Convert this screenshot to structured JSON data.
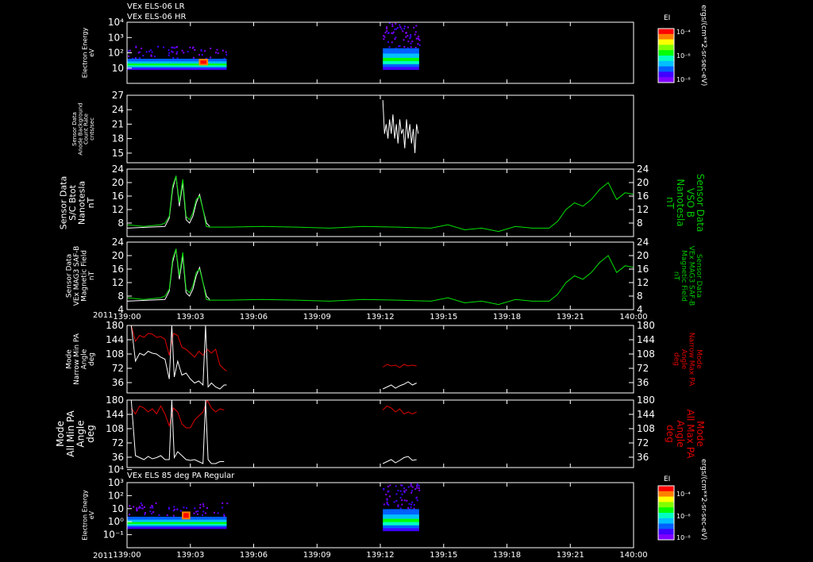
{
  "header": {
    "line1": "VEx ELS-06 LR",
    "line2": "VEx ELS-06 HR",
    "bottom_title": "VEx ELS 85 deg PA Regular",
    "year_label": "2011"
  },
  "colorbar": {
    "title": "EI",
    "unit": "ergs/(cm**2-sr-sec-eV)",
    "ticks": [
      "10⁻⁴",
      "10⁻⁶",
      "10⁻⁸"
    ],
    "colors": [
      "#ff0000",
      "#ff8000",
      "#ffff00",
      "#80ff00",
      "#00ff00",
      "#00ffc0",
      "#00c0ff",
      "#0060ff",
      "#4000ff",
      "#8000ff"
    ]
  },
  "colors": {
    "white": "#ffffff",
    "green": "#00e000",
    "red": "#e00000",
    "frame": "#ffffff",
    "label_green": "#00c800",
    "label_red": "#e00000"
  },
  "chart_data": {
    "type": "line",
    "x_tick_labels": [
      "139:00",
      "139:03",
      "139:06",
      "139:09",
      "139:12",
      "139:15",
      "139:18",
      "139:21",
      "140:00"
    ],
    "xlim": [
      0,
      60
    ],
    "x_unit": "minutes after 139:00",
    "panels": [
      {
        "id": "els-lr-hr",
        "type": "heatmap",
        "ylabel": [
          "Electron Energy",
          "eV"
        ],
        "ytick_labels": [
          "10",
          "10²",
          "10³",
          "10⁴"
        ],
        "ylog": true,
        "ylim": [
          1,
          10000
        ],
        "segments": [
          {
            "x0": 0,
            "x1": 11.8,
            "y_band": [
              8,
              300
            ],
            "peak_x": [
              8.5,
              9.6
            ],
            "peak_y": [
              15,
              40
            ]
          },
          {
            "x0": 30.3,
            "x1": 34.6,
            "y_band": [
              8,
              10000
            ],
            "peak_y": [
              10,
              40
            ]
          }
        ]
      },
      {
        "id": "anode-background",
        "ylabel": [
          "Sensor Data",
          "Anode Background",
          "Count Rate",
          "cnts/sec"
        ],
        "ytick_labels": [
          "15",
          "18",
          "21",
          "24",
          "27"
        ],
        "ylim": [
          13,
          27
        ],
        "series": [
          {
            "color_key": "white",
            "x": [
              30.3,
              30.5,
              30.7,
              30.9,
              31.1,
              31.3,
              31.5,
              31.7,
              31.9,
              32.1,
              32.3,
              32.5,
              32.7,
              32.9,
              33.1,
              33.3,
              33.5,
              33.7,
              33.9,
              34.1,
              34.3,
              34.5
            ],
            "y": [
              26,
              19,
              21,
              18,
              22,
              19,
              23,
              18,
              21,
              17,
              22,
              19,
              20,
              16,
              22,
              18,
              21,
              17,
              20,
              15,
              21,
              19
            ]
          }
        ]
      },
      {
        "id": "bmag-sc",
        "ylabel": [
          "Sensor Data",
          "S/C Btot",
          "Nanotesla",
          "nT"
        ],
        "ylabel_right": [
          "Sensor Data",
          "VSO B",
          "Nanotesla",
          "nT"
        ],
        "ytick_labels": [
          "8",
          "12",
          "16",
          "20",
          "24"
        ],
        "ylim": [
          4,
          24
        ],
        "series": [
          {
            "color_key": "white",
            "x": [
              0,
              4.5,
              5.0,
              5.4,
              5.8,
              6.2,
              6.6,
              7.0,
              7.4,
              7.8,
              8.2,
              8.6,
              9.0,
              9.4,
              9.8
            ],
            "y": [
              6.5,
              7.0,
              9.5,
              18.0,
              22.0,
              13.0,
              20.0,
              9.0,
              8.0,
              10.0,
              14.0,
              16.5,
              12.0,
              8.0,
              7.0
            ]
          },
          {
            "color_key": "green",
            "x": [
              0,
              2,
              4,
              4.5,
              5.0,
              5.4,
              5.8,
              6.2,
              6.6,
              7.0,
              7.4,
              7.8,
              8.2,
              8.6,
              9.0,
              9.4,
              9.8,
              12,
              16,
              20,
              24,
              28,
              32,
              36,
              38,
              40,
              42,
              44,
              46,
              48,
              50,
              51,
              52,
              53,
              54,
              55,
              56,
              57,
              58,
              59,
              60
            ],
            "y": [
              7.5,
              7.0,
              7.5,
              8.0,
              10.0,
              19.0,
              22.0,
              14.0,
              21.0,
              10.0,
              9.0,
              11.0,
              15.0,
              16.0,
              12.0,
              7.0,
              6.8,
              6.8,
              7.0,
              6.8,
              6.5,
              7.0,
              6.8,
              6.5,
              7.5,
              6.0,
              6.5,
              5.5,
              7.0,
              6.5,
              6.5,
              8.5,
              12.0,
              14.0,
              13.0,
              15.0,
              18.0,
              20.0,
              15.0,
              17.0,
              16.5
            ]
          }
        ]
      },
      {
        "id": "bmag-mag",
        "ylabel": [
          "Sensor Data",
          "VEx MAG3 SAF-B",
          "Magnetic Field",
          "nT"
        ],
        "ylabel_right": [
          "Sensor Data",
          "VEx MAG3 SAF-B",
          "Magnetic Field",
          "nT"
        ],
        "ytick_labels": [
          "4",
          "8",
          "12",
          "16",
          "20",
          "24"
        ],
        "ylim": [
          4,
          24
        ],
        "series": [
          {
            "color_key": "white",
            "x": [
              0,
              4.5,
              5.0,
              5.4,
              5.8,
              6.2,
              6.6,
              7.0,
              7.4,
              7.8,
              8.2,
              8.6,
              9.0,
              9.4,
              9.8
            ],
            "y": [
              6.5,
              7.0,
              9.5,
              18.0,
              22.0,
              13.0,
              20.0,
              9.0,
              8.0,
              10.0,
              14.0,
              16.5,
              12.0,
              8.0,
              7.0
            ]
          },
          {
            "color_key": "green",
            "x": [
              0,
              2,
              4,
              4.5,
              5.0,
              5.4,
              5.8,
              6.2,
              6.6,
              7.0,
              7.4,
              7.8,
              8.2,
              8.6,
              9.0,
              9.4,
              9.8,
              12,
              16,
              20,
              24,
              28,
              32,
              36,
              38,
              40,
              42,
              44,
              46,
              48,
              50,
              51,
              52,
              53,
              54,
              55,
              56,
              57,
              58,
              59,
              60
            ],
            "y": [
              7.5,
              7.0,
              7.5,
              8.0,
              10.0,
              19.0,
              22.0,
              14.0,
              21.0,
              10.0,
              9.0,
              11.0,
              15.0,
              16.0,
              12.0,
              7.0,
              6.8,
              6.8,
              7.0,
              6.8,
              6.5,
              7.0,
              6.8,
              6.5,
              7.5,
              6.0,
              6.5,
              5.5,
              7.0,
              6.5,
              6.5,
              8.5,
              12.0,
              14.0,
              13.0,
              15.0,
              18.0,
              20.0,
              15.0,
              17.0,
              16.5
            ]
          }
        ]
      },
      {
        "id": "pa-narrow",
        "ylabel": [
          "Mode",
          "Narrow Min PA",
          "Angle",
          "deg"
        ],
        "ylabel_right": [
          "Mode",
          "Narrow Max PA",
          "Angle",
          "deg"
        ],
        "ytick_labels": [
          "36",
          "72",
          "108",
          "144",
          "180"
        ],
        "ylim": [
          10,
          180
        ],
        "series": [
          {
            "color_key": "red",
            "x": [
              0.5,
              1.0,
              1.5,
              2.0,
              2.5,
              3.0,
              3.5,
              4.0,
              4.5,
              5.0,
              5.5,
              6.0,
              6.5,
              7.0,
              7.5,
              8.0,
              8.5,
              9.0,
              9.5,
              10.0,
              10.5,
              11.0,
              11.5,
              11.8
            ],
            "y": [
              180,
              140,
              155,
              150,
              160,
              158,
              150,
              152,
              145,
              105,
              160,
              155,
              125,
              120,
              110,
              100,
              115,
              105,
              120,
              110,
              120,
              80,
              70,
              65
            ]
          },
          {
            "color_key": "white",
            "x": [
              0.5,
              1.0,
              1.5,
              2.0,
              2.5,
              3.0,
              3.5,
              4.0,
              4.5,
              5.0,
              5.3,
              5.6,
              6.0,
              6.5,
              7.0,
              7.5,
              8.0,
              8.5,
              9.0,
              9.3,
              9.6,
              10.0,
              10.5,
              11.0,
              11.5,
              11.8
            ],
            "y": [
              180,
              90,
              110,
              105,
              115,
              110,
              108,
              100,
              95,
              45,
              180,
              50,
              90,
              55,
              60,
              45,
              35,
              40,
              30,
              180,
              25,
              35,
              25,
              20,
              30,
              30
            ]
          },
          {
            "color_key": "red",
            "x": [
              30.3,
              30.8,
              31.3,
              31.8,
              32.3,
              32.8,
              33.3,
              33.8,
              34.3
            ],
            "y": [
              75,
              82,
              78,
              80,
              74,
              82,
              78,
              80,
              78
            ]
          },
          {
            "color_key": "white",
            "x": [
              30.3,
              30.8,
              31.3,
              31.8,
              32.3,
              32.8,
              33.3,
              33.8,
              34.3
            ],
            "y": [
              20,
              25,
              30,
              22,
              28,
              32,
              38,
              30,
              35
            ]
          }
        ]
      },
      {
        "id": "pa-all",
        "ylabel": [
          "Mode",
          "All Min PA",
          "Angle",
          "deg"
        ],
        "ylabel_right": [
          "Mode",
          "All Max PA",
          "Angle",
          "deg"
        ],
        "ytick_labels": [
          "36",
          "72",
          "108",
          "144",
          "180"
        ],
        "ylim": [
          10,
          180
        ],
        "series": [
          {
            "color_key": "red",
            "x": [
              0.5,
              1.0,
              1.5,
              2.0,
              2.5,
              3.0,
              3.5,
              4.0,
              4.5,
              5.0,
              5.5,
              6.0,
              6.5,
              7.0,
              7.5,
              8.0,
              8.5,
              9.0,
              9.5,
              10.0,
              10.5,
              11.0,
              11.5
            ],
            "y": [
              160,
              145,
              165,
              160,
              150,
              158,
              145,
              165,
              145,
              115,
              160,
              150,
              120,
              110,
              110,
              130,
              140,
              150,
              180,
              160,
              150,
              158,
              155
            ]
          },
          {
            "color_key": "white",
            "x": [
              0.5,
              1.0,
              1.5,
              2.0,
              2.5,
              3.0,
              3.5,
              4.0,
              4.5,
              5.0,
              5.3,
              5.6,
              6.0,
              6.5,
              7.0,
              7.5,
              8.0,
              8.5,
              9.0,
              9.3,
              9.6,
              10.0,
              10.5,
              11.0,
              11.5
            ],
            "y": [
              180,
              40,
              35,
              30,
              38,
              32,
              35,
              40,
              30,
              30,
              180,
              35,
              50,
              40,
              30,
              28,
              30,
              25,
              20,
              180,
              30,
              20,
              20,
              25,
              25
            ]
          },
          {
            "color_key": "red",
            "x": [
              30.3,
              30.8,
              31.3,
              31.8,
              32.3,
              32.8,
              33.3,
              33.8,
              34.3
            ],
            "y": [
              155,
              165,
              160,
              150,
              158,
              145,
              150,
              145,
              150
            ]
          },
          {
            "color_key": "white",
            "x": [
              30.3,
              30.8,
              31.3,
              31.8,
              32.3,
              32.8,
              33.3,
              33.8,
              34.3
            ],
            "y": [
              20,
              25,
              30,
              22,
              28,
              35,
              38,
              28,
              30
            ]
          }
        ]
      },
      {
        "id": "els-85pa",
        "type": "heatmap",
        "ylabel": [
          "Electron Energy",
          "eV"
        ],
        "ytick_labels": [
          "10⁻¹",
          "10⁰",
          "10",
          "10²",
          "10³",
          "10⁴"
        ],
        "ylog": true,
        "ylim": [
          0.1,
          10000
        ],
        "segments": [
          {
            "x0": 0,
            "x1": 11.8,
            "y_band": [
              3,
              300
            ],
            "peak_x": [
              6.5,
              7.5
            ],
            "peak_y": [
              15,
              60
            ]
          },
          {
            "x0": 30.3,
            "x1": 34.6,
            "y_band": [
              2,
              10000
            ],
            "peak_y": [
              10,
              40
            ]
          }
        ]
      }
    ]
  }
}
